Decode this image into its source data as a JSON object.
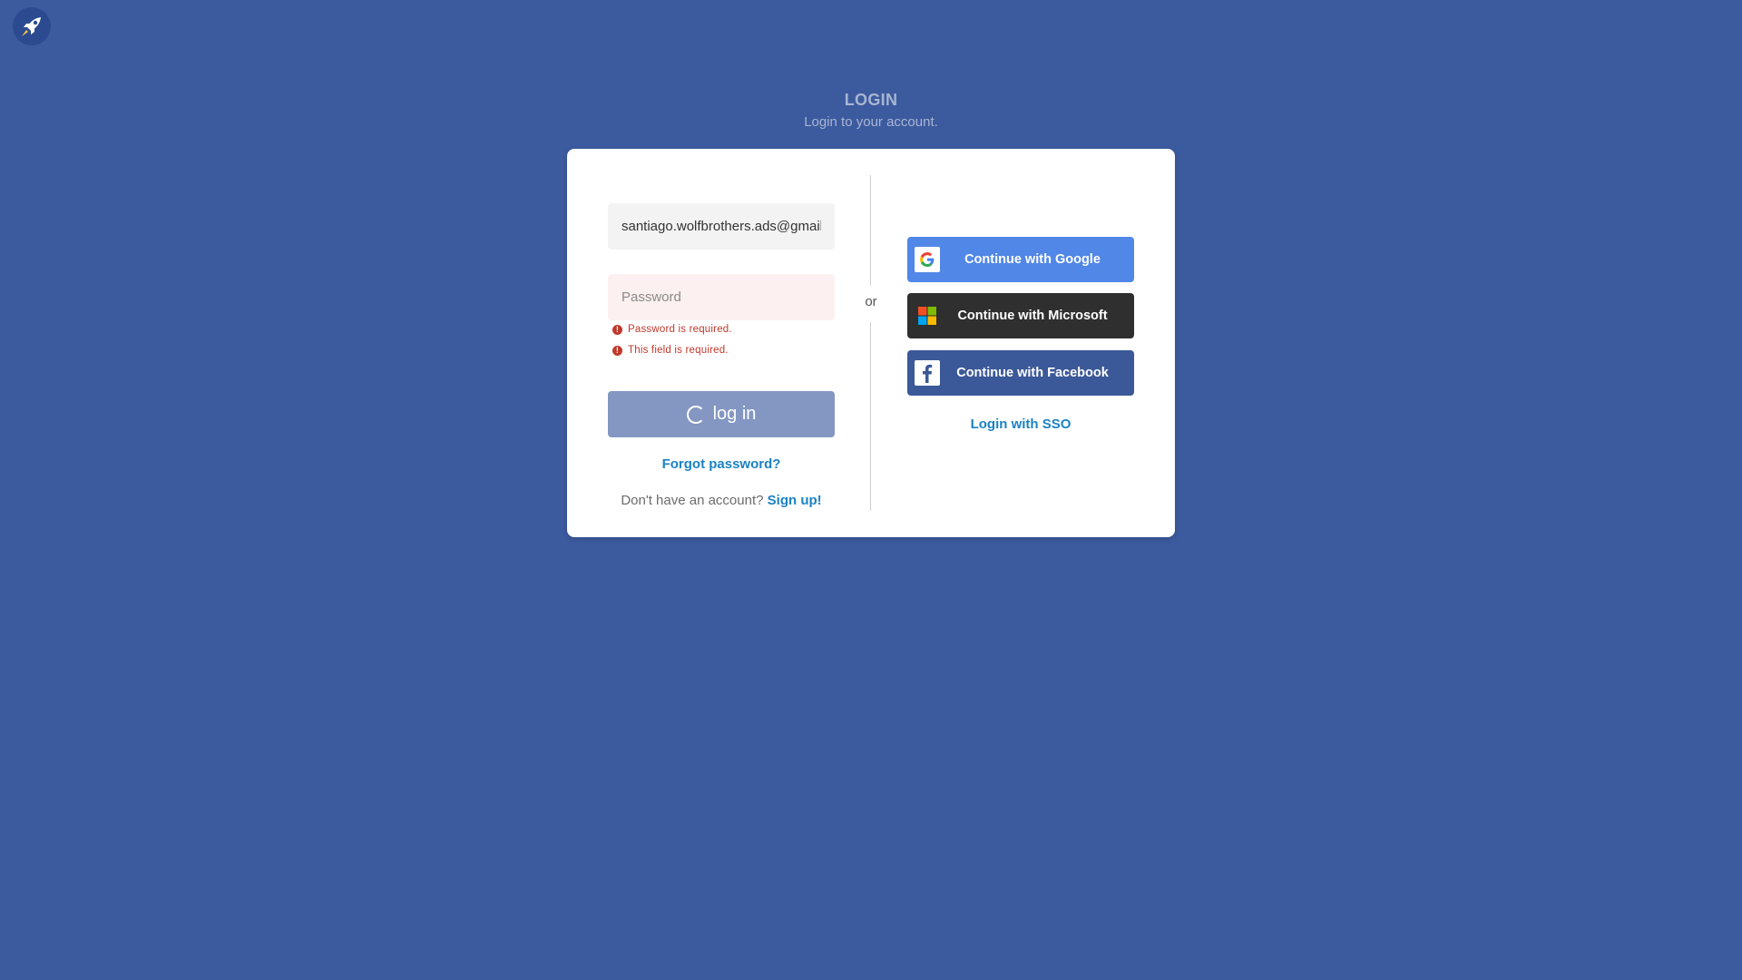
{
  "app": {
    "logo_icon": "rocket-icon"
  },
  "header": {
    "title": "LOGIN",
    "subtitle": "Login to your account."
  },
  "form": {
    "email_value": "santiago.wolfbrothers.ads@gmail",
    "password_placeholder": "Password",
    "errors": [
      "Password is required.",
      "This field is required."
    ],
    "login_label": "log in",
    "forgot_label": "Forgot password?",
    "signup_prompt": "Don't have an account?",
    "signup_label": "Sign up!"
  },
  "divider_text": "or",
  "social": {
    "google_label": "Continue with Google",
    "microsoft_label": "Continue with Microsoft",
    "facebook_label": "Continue with Facebook",
    "sso_label": "Login with SSO"
  },
  "colors": {
    "background": "#3c5a9e",
    "google": "#5187e6",
    "microsoft": "#2f2f2f",
    "facebook": "#3b5998",
    "link": "#1b82c4",
    "error": "#c0392b",
    "login_button": "#8497c2"
  }
}
